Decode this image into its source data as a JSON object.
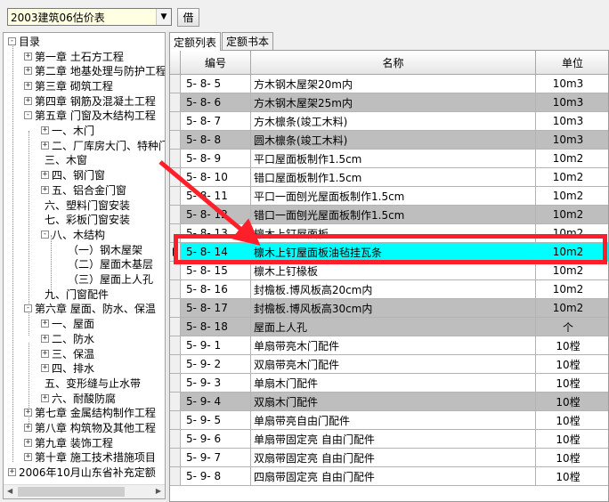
{
  "toolbar": {
    "quota_book": "2003建筑06估价表",
    "borrow_label": "借"
  },
  "tree": {
    "root": "目录",
    "nodes": [
      {
        "label": "第一章  土石方工程",
        "toggle": "+",
        "level": 1
      },
      {
        "label": "第二章  地基处理与防护工程",
        "toggle": "+",
        "level": 1
      },
      {
        "label": "第三章  砌筑工程",
        "toggle": "+",
        "level": 1
      },
      {
        "label": "第四章  钢筋及混凝土工程",
        "toggle": "+",
        "level": 1
      },
      {
        "label": "第五章  门窗及木结构工程",
        "toggle": "-",
        "level": 1
      },
      {
        "label": "一、木门",
        "toggle": "+",
        "level": 2
      },
      {
        "label": "二、厂库房大门、特种门",
        "toggle": "+",
        "level": 2
      },
      {
        "label": "三、木窗",
        "toggle": "",
        "level": 2
      },
      {
        "label": "四、钢门窗",
        "toggle": "+",
        "level": 2
      },
      {
        "label": "五、铝合金门窗",
        "toggle": "+",
        "level": 2
      },
      {
        "label": "六、塑料门窗安装",
        "toggle": "",
        "level": 2
      },
      {
        "label": "七、彩板门窗安装",
        "toggle": "",
        "level": 2
      },
      {
        "label": "八、木结构",
        "toggle": "-",
        "level": 2
      },
      {
        "label": "（一）钢木屋架",
        "toggle": "",
        "level": 3
      },
      {
        "label": "（二）屋面木基层",
        "toggle": "",
        "level": 3
      },
      {
        "label": "（三）屋面上人孔",
        "toggle": "",
        "level": 3
      },
      {
        "label": "九、门窗配件",
        "toggle": "",
        "level": 2
      },
      {
        "label": "第六章  屋面、防水、保温",
        "toggle": "-",
        "level": 1
      },
      {
        "label": "一、屋面",
        "toggle": "+",
        "level": 2
      },
      {
        "label": "二、防水",
        "toggle": "+",
        "level": 2
      },
      {
        "label": "三、保温",
        "toggle": "+",
        "level": 2
      },
      {
        "label": "四、排水",
        "toggle": "+",
        "level": 2
      },
      {
        "label": "五、变形缝与止水带",
        "toggle": "",
        "level": 2
      },
      {
        "label": "六、耐酸防腐",
        "toggle": "+",
        "level": 2
      },
      {
        "label": "第七章  金属结构制作工程",
        "toggle": "+",
        "level": 1
      },
      {
        "label": "第八章  构筑物及其他工程",
        "toggle": "+",
        "level": 1
      },
      {
        "label": "第九章  装饰工程",
        "toggle": "+",
        "level": 1
      },
      {
        "label": "第十章  施工技术措施项目",
        "toggle": "+",
        "level": 1
      },
      {
        "label": "2006年10月山东省补充定额",
        "toggle": "+",
        "level": 0
      }
    ]
  },
  "tabs": [
    {
      "label": "定额列表",
      "active": true
    },
    {
      "label": "定额书本",
      "active": false
    }
  ],
  "table": {
    "headers": {
      "code": "编号",
      "name": "名称",
      "unit": "单位"
    },
    "rows": [
      {
        "code": "5- 8-  5",
        "name": "方木钢木屋架20m内",
        "unit": "10m3",
        "style": "white"
      },
      {
        "code": "5- 8-  6",
        "name": "方木钢木屋架25m内",
        "unit": "10m3",
        "style": "gray"
      },
      {
        "code": "5- 8-  7",
        "name": "方木檩条(竣工木料)",
        "unit": "10m3",
        "style": "white"
      },
      {
        "code": "5- 8-  8",
        "name": "圆木檩条(竣工木料)",
        "unit": "10m3",
        "style": "gray"
      },
      {
        "code": "5- 8-  9",
        "name": "平口屋面板制作1.5cm",
        "unit": "10m2",
        "style": "white"
      },
      {
        "code": "5- 8-  10",
        "name": "错口屋面板制作1.5cm",
        "unit": "10m2",
        "style": "white"
      },
      {
        "code": "5- 8-  11",
        "name": "平口一面刨光屋面板制作1.5cm",
        "unit": "10m2",
        "style": "white"
      },
      {
        "code": "5- 8-  12",
        "name": "错口一面刨光屋面板制作1.5cm",
        "unit": "10m2",
        "style": "gray"
      },
      {
        "code": "5- 8-  13",
        "name": "檩木上钉屋面板",
        "unit": "10m2",
        "style": "white"
      },
      {
        "code": "5- 8-  14",
        "name": "檩木上钉屋面板油毡挂瓦条",
        "unit": "10m2",
        "style": "sel",
        "current": true
      },
      {
        "code": "5- 8-  15",
        "name": "檩木上钉椽板",
        "unit": "10m2",
        "style": "white"
      },
      {
        "code": "5- 8-  16",
        "name": "封檐板.博风板高20cm内",
        "unit": "10m2",
        "style": "white"
      },
      {
        "code": "5- 8-  17",
        "name": "封檐板.博风板高30cm内",
        "unit": "10m2",
        "style": "gray"
      },
      {
        "code": "5- 8-  18",
        "name": "屋面上人孔",
        "unit": "个",
        "style": "gray"
      },
      {
        "code": "5- 9-  1",
        "name": "单扇带亮木门配件",
        "unit": "10樘",
        "style": "white"
      },
      {
        "code": "5- 9-  2",
        "name": "双扇带亮木门配件",
        "unit": "10樘",
        "style": "white"
      },
      {
        "code": "5- 9-  3",
        "name": "单扇木门配件",
        "unit": "10樘",
        "style": "white"
      },
      {
        "code": "5- 9-  4",
        "name": "双扇木门配件",
        "unit": "10樘",
        "style": "gray"
      },
      {
        "code": "5- 9-  5",
        "name": "单扇带亮自由门配件",
        "unit": "10樘",
        "style": "white"
      },
      {
        "code": "5- 9-  6",
        "name": "单扇带固定亮 自由门配件",
        "unit": "10樘",
        "style": "white"
      },
      {
        "code": "5- 9-  7",
        "name": "双扇带固定亮 自由门配件",
        "unit": "10樘",
        "style": "white"
      },
      {
        "code": "5- 9-  8",
        "name": "四扇带固定亮 自由门配件",
        "unit": "10樘",
        "style": "white"
      }
    ]
  },
  "colors": {
    "selected_row": "#00ffff",
    "alt_row": "#bebebe",
    "annotation": "#ff1f2b"
  }
}
